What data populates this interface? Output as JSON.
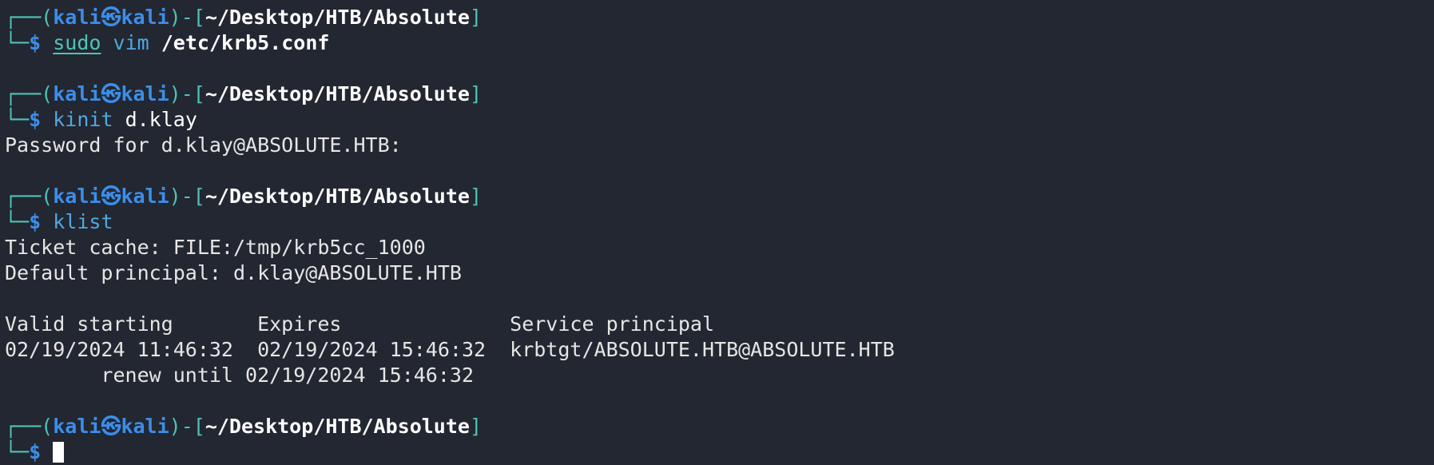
{
  "prompt": {
    "top_open": "┌──(",
    "user": "kali",
    "skull": "㉿",
    "host": "kali",
    "mid": ")-[",
    "path": "~/Desktop/HTB/Absolute",
    "close": "]",
    "bottom": "└─",
    "dollar": "$"
  },
  "commands": {
    "c1_cmd": "sudo",
    "c1_rest": "vim",
    "c1_arg": "/etc/krb5.conf",
    "c2_cmd": "kinit",
    "c2_arg": "d.klay",
    "c3_cmd": "klist"
  },
  "output": {
    "password_prompt": "Password for d.klay@ABSOLUTE.HTB:",
    "ticket_cache": "Ticket cache: FILE:/tmp/krb5cc_1000",
    "default_principal": "Default principal: d.klay@ABSOLUTE.HTB",
    "table_header": "Valid starting       Expires              Service principal",
    "table_row": "02/19/2024 11:46:32  02/19/2024 15:46:32  krbtgt/ABSOLUTE.HTB@ABSOLUTE.HTB",
    "renew_line": "        renew until 02/19/2024 15:46:32"
  }
}
